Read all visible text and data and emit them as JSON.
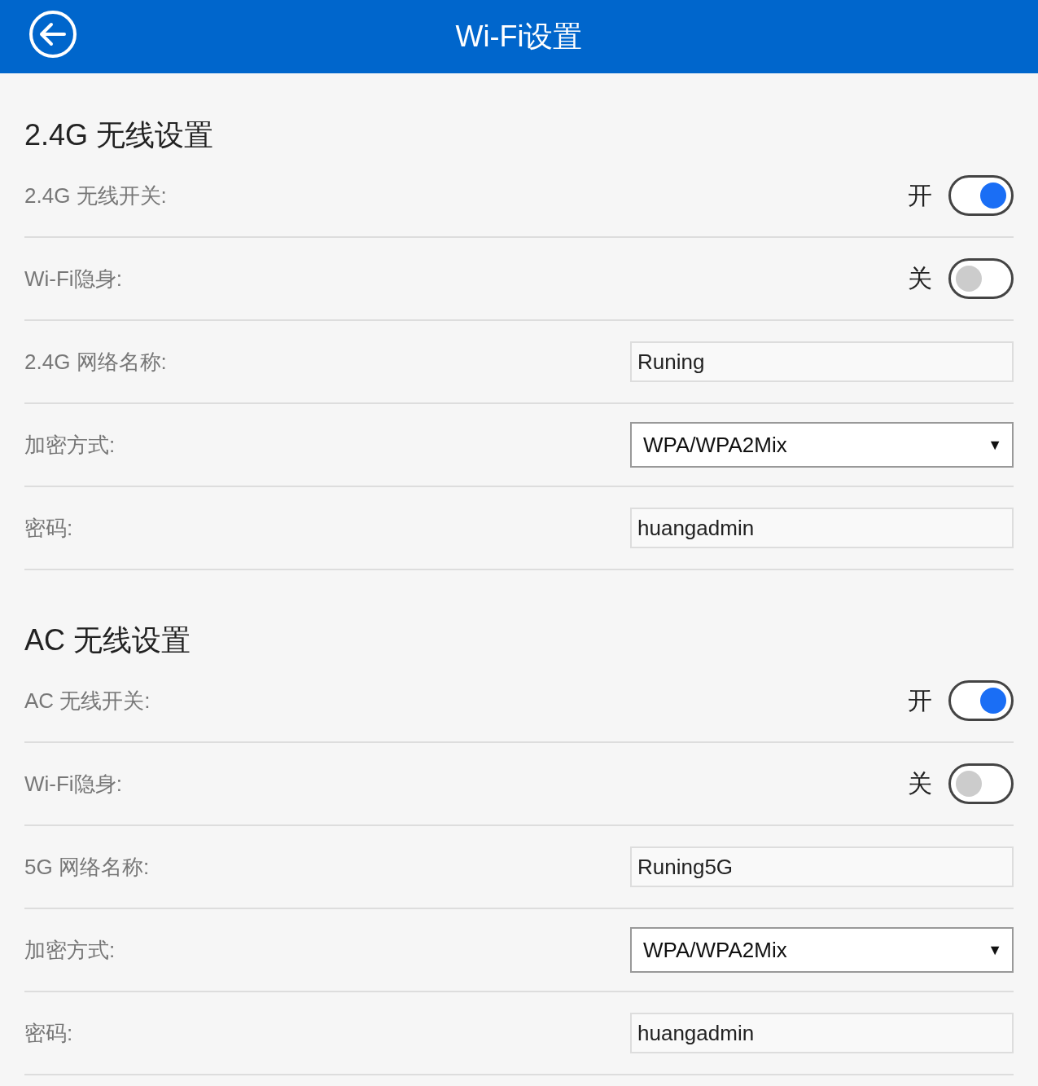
{
  "header": {
    "title": "Wi-Fi设置"
  },
  "sections": [
    {
      "title": "2.4G 无线设置",
      "rows": [
        {
          "kind": "toggle",
          "label": "2.4G 无线开关:",
          "state_label": "开",
          "on": true
        },
        {
          "kind": "toggle",
          "label": "Wi-Fi隐身:",
          "state_label": "关",
          "on": false
        },
        {
          "kind": "text",
          "label": "2.4G 网络名称:",
          "value": "Runing"
        },
        {
          "kind": "select",
          "label": "加密方式:",
          "value": "WPA/WPA2Mix",
          "arrow": "▼"
        },
        {
          "kind": "text",
          "label": "密码:",
          "value": "huangadmin"
        }
      ]
    },
    {
      "title": "AC 无线设置",
      "rows": [
        {
          "kind": "toggle",
          "label": "AC 无线开关:",
          "state_label": "开",
          "on": true
        },
        {
          "kind": "toggle",
          "label": "Wi-Fi隐身:",
          "state_label": "关",
          "on": false
        },
        {
          "kind": "text",
          "label": "5G 网络名称:",
          "value": "Runing5G"
        },
        {
          "kind": "select",
          "label": "加密方式:",
          "value": "WPA/WPA2Mix",
          "arrow": "▼"
        },
        {
          "kind": "text",
          "label": "密码:",
          "value": "huangadmin"
        }
      ]
    }
  ]
}
